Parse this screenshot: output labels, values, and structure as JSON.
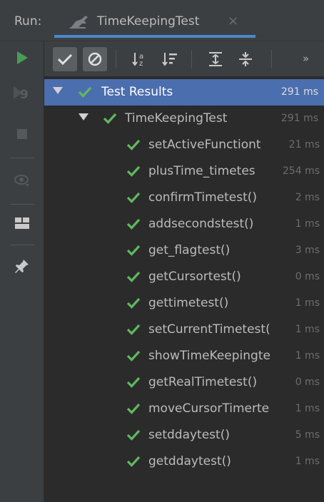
{
  "header": {
    "run_label": "Run:",
    "tab_title": "TimeKeepingTest",
    "tab_icon": "test-runner-icon",
    "close_glyph": "×"
  },
  "toolbar": {
    "show_passed": "show-passed-icon",
    "show_ignored": "show-ignored-icon",
    "sort_alpha": "sort-alphabetically-icon",
    "sort_duration": "sort-by-duration-icon",
    "expand_all": "expand-all-icon",
    "collapse_all": "collapse-all-icon",
    "more": "»"
  },
  "left_actions": [
    "rerun-icon",
    "rerun-failed-icon",
    "stop-icon",
    "toggle-autotest-icon",
    "layout-icon",
    "pin-icon"
  ],
  "colors": {
    "pass": "#5fb85f",
    "selection": "#4b6eaf",
    "tab_accent": "#4a88c7"
  },
  "tree": {
    "root": {
      "label": "Test Results",
      "time": "291 ms"
    },
    "suite": {
      "label": "TimeKeepingTest",
      "time": "291 ms"
    },
    "tests": [
      {
        "label": "setActiveFunctiont",
        "time": "21 ms"
      },
      {
        "label": "plusTime_timetes",
        "time": "254 ms"
      },
      {
        "label": "confirmTimetest()",
        "time": "2 ms"
      },
      {
        "label": "addsecondstest()",
        "time": "1 ms"
      },
      {
        "label": "get_flagtest()",
        "time": "3 ms"
      },
      {
        "label": "getCursortest()",
        "time": "0 ms"
      },
      {
        "label": "gettimetest()",
        "time": "1 ms"
      },
      {
        "label": "setCurrentTimetest(",
        "time": "1 ms"
      },
      {
        "label": "showTimeKeepingte",
        "time": "1 ms"
      },
      {
        "label": "getRealTimetest()",
        "time": "0 ms"
      },
      {
        "label": "moveCursorTimerte",
        "time": "1 ms"
      },
      {
        "label": "setddaytest()",
        "time": "5 ms"
      },
      {
        "label": "getddaytest()",
        "time": "1 ms"
      }
    ]
  }
}
